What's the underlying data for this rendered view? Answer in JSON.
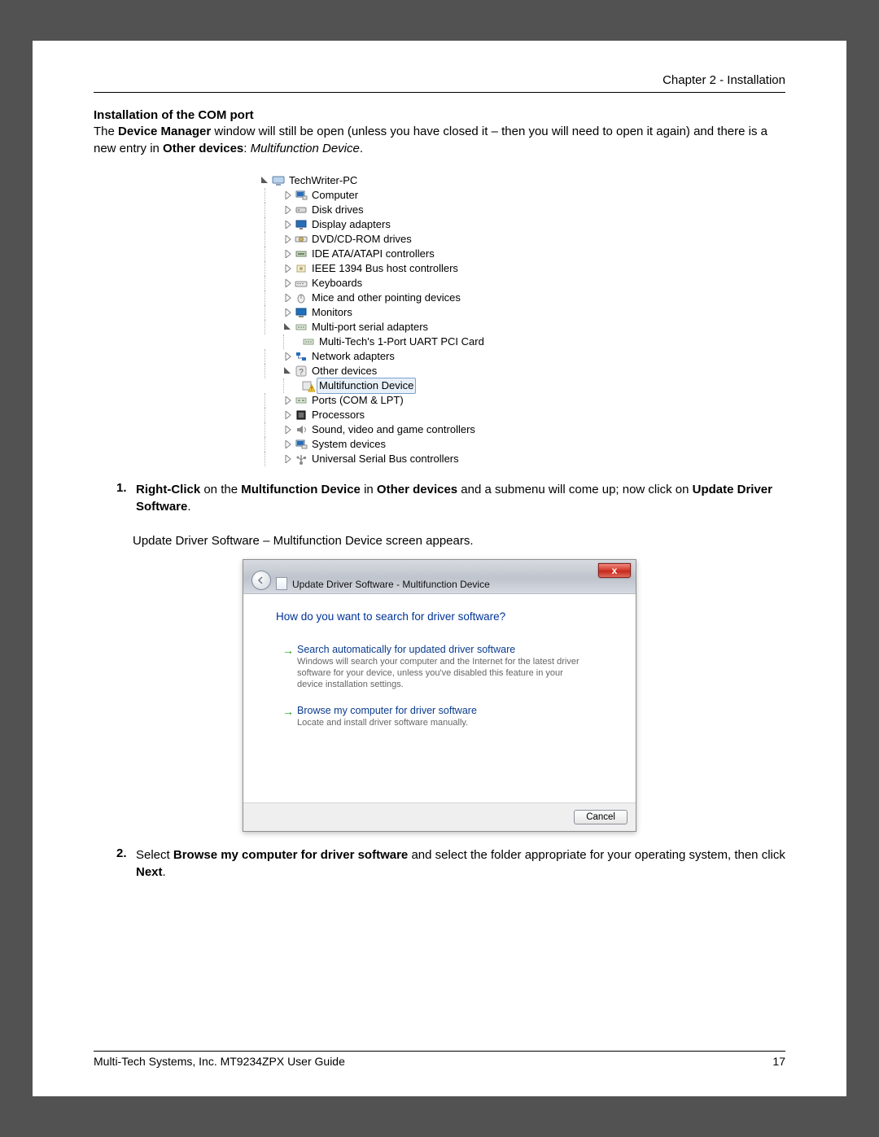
{
  "header": {
    "chapter": "Chapter 2 - Installation"
  },
  "section": {
    "title": "Installation of the COM port",
    "intro_pre": "The ",
    "intro_b1": "Device Manager",
    "intro_mid": " window will still be open (unless you have closed it – then you will need to open it again) and there is a new entry in ",
    "intro_b2": "Other devices",
    "intro_sep": ": ",
    "intro_i": "Multifunction Device",
    "intro_end": "."
  },
  "devtree": {
    "root": "TechWriter-PC",
    "items": [
      {
        "id": "computer",
        "label": "Computer",
        "expanded": false,
        "icon": "computer-icon"
      },
      {
        "id": "disk",
        "label": "Disk drives",
        "expanded": false,
        "icon": "disk-icon"
      },
      {
        "id": "display",
        "label": "Display adapters",
        "expanded": false,
        "icon": "display-icon"
      },
      {
        "id": "dvd",
        "label": "DVD/CD-ROM drives",
        "expanded": false,
        "icon": "dvd-icon"
      },
      {
        "id": "ide",
        "label": "IDE ATA/ATAPI controllers",
        "expanded": false,
        "icon": "ide-icon"
      },
      {
        "id": "ieee",
        "label": "IEEE 1394 Bus host controllers",
        "expanded": false,
        "icon": "ieee-icon"
      },
      {
        "id": "kb",
        "label": "Keyboards",
        "expanded": false,
        "icon": "keyboard-icon"
      },
      {
        "id": "mice",
        "label": "Mice and other pointing devices",
        "expanded": false,
        "icon": "mouse-icon"
      },
      {
        "id": "mon",
        "label": "Monitors",
        "expanded": false,
        "icon": "monitor-icon"
      },
      {
        "id": "mpsa",
        "label": "Multi-port serial adapters",
        "expanded": true,
        "icon": "serial-icon",
        "children": [
          {
            "label": "Multi-Tech's 1-Port UART PCI Card",
            "icon": "serial-icon"
          }
        ]
      },
      {
        "id": "net",
        "label": "Network adapters",
        "expanded": false,
        "icon": "network-icon"
      },
      {
        "id": "other",
        "label": "Other devices",
        "expanded": true,
        "icon": "unknown-icon",
        "children": [
          {
            "label": "Multifunction Device",
            "icon": "warning-icon",
            "selected": true
          }
        ]
      },
      {
        "id": "ports",
        "label": "Ports (COM & LPT)",
        "expanded": false,
        "icon": "port-icon"
      },
      {
        "id": "proc",
        "label": "Processors",
        "expanded": false,
        "icon": "cpu-icon"
      },
      {
        "id": "sound",
        "label": "Sound, video and game controllers",
        "expanded": false,
        "icon": "sound-icon"
      },
      {
        "id": "sys",
        "label": "System devices",
        "expanded": false,
        "icon": "system-icon"
      },
      {
        "id": "usb",
        "label": "Universal Serial Bus controllers",
        "expanded": false,
        "icon": "usb-icon"
      }
    ]
  },
  "step1": {
    "num": "1.",
    "t1": "Right-Click",
    "t2": " on the ",
    "t3": "Multifunction Device",
    "t4": " in ",
    "t5": "Other devices",
    "t6": " and a submenu will come up; now click on ",
    "t7": "Update Driver Software",
    "t8": ".",
    "after": "Update Driver Software – Multifunction Device screen appears."
  },
  "dialog": {
    "title": "Update Driver Software - Multifunction Device",
    "question": "How do you want to search for driver software?",
    "opt1": {
      "title": "Search automatically for updated driver software",
      "desc": "Windows will search your computer and the Internet for the latest driver software for your device, unless you've disabled this feature in your device installation settings."
    },
    "opt2": {
      "title": "Browse my computer for driver software",
      "desc": "Locate and install driver software manually."
    },
    "cancel": "Cancel",
    "close": "x"
  },
  "step2": {
    "num": "2.",
    "t1": "Select ",
    "t2": "Browse my computer for driver software",
    "t3": " and select the folder appropriate for your operating system, then click ",
    "t4": "Next",
    "t5": "."
  },
  "footer": {
    "left": "Multi-Tech Systems, Inc. MT9234ZPX User Guide",
    "right": "17"
  },
  "glyph": {
    "tri_closed": "▷",
    "tri_open": "◢",
    "arrow": "→"
  }
}
